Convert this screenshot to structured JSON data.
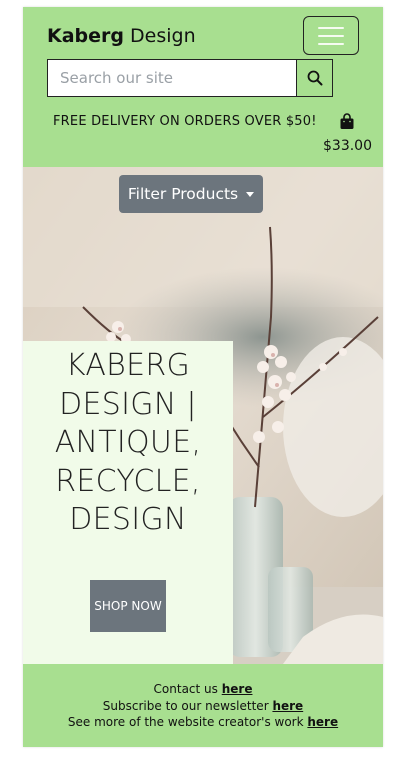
{
  "header": {
    "brand_bold": "Kaberg",
    "brand_light": " Design",
    "search_placeholder": "Search our site",
    "delivery_text": "FREE DELIVERY ON ORDERS OVER $50!",
    "cart_total": "$33.00"
  },
  "hero": {
    "filter_label": "Filter Products",
    "title_lines": [
      "KABERG",
      "DESIGN |",
      "ANTIQUE,",
      "RECYCLE,",
      "DESIGN"
    ],
    "shop_label": "SHOP NOW"
  },
  "footer": {
    "contact_prefix": "Contact us ",
    "contact_link": "here",
    "newsletter_prefix": "Subscribe to our newsletter ",
    "newsletter_link": "here",
    "creator_prefix": "See more of the website creator's work ",
    "creator_link": "here"
  },
  "colors": {
    "header_green": "#a8df90",
    "card_bg": "#f1fbe9",
    "button_gray": "#6c757d"
  },
  "icons": [
    "menu-icon",
    "search-icon",
    "shopping-bag-icon",
    "caret-down-icon"
  ]
}
